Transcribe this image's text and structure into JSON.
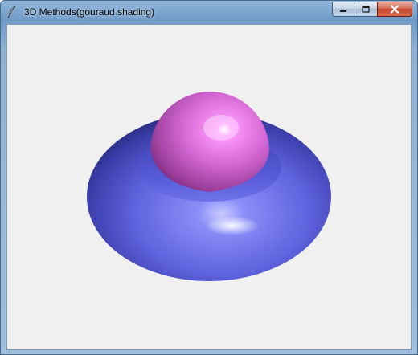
{
  "window": {
    "title": "3D Methods(gouraud shading)",
    "controls": {
      "minimize_icon": "minimize-icon",
      "maximize_icon": "maximize-icon",
      "close_icon": "close-icon"
    }
  },
  "scene": {
    "objects": [
      {
        "name": "torus",
        "color": "#6b6ff0"
      },
      {
        "name": "sphere",
        "color": "#e07ae0"
      }
    ],
    "background": "#f0f0f0"
  }
}
